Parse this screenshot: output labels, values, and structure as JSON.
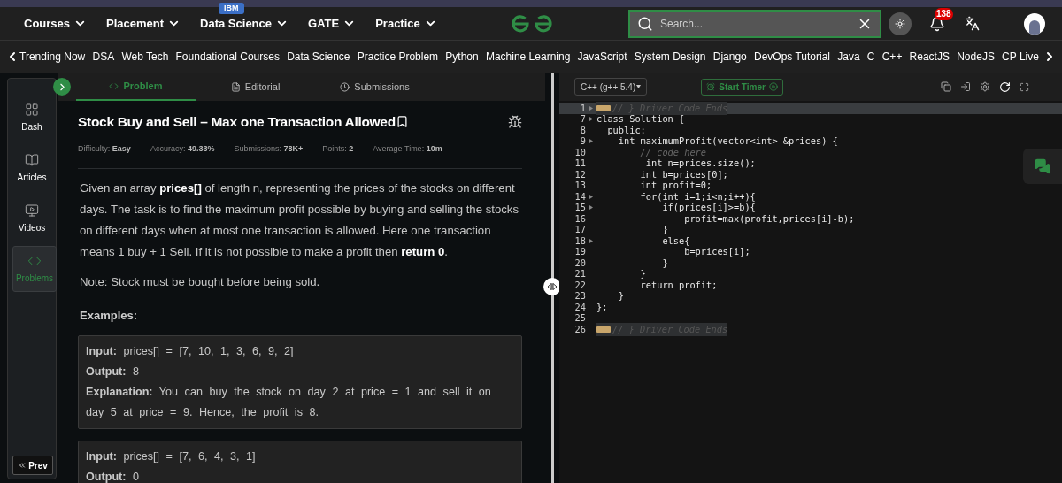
{
  "nav": {
    "items": [
      {
        "label": "Courses"
      },
      {
        "label": "Placement"
      },
      {
        "label": "Data Science",
        "badge": "IBM"
      },
      {
        "label": "GATE"
      },
      {
        "label": "Practice"
      }
    ],
    "search": {
      "placeholder": "Search..."
    },
    "notifications": "138"
  },
  "topics": [
    "Trending Now",
    "DSA",
    "Web Tech",
    "Foundational Courses",
    "Data Science",
    "Practice Problem",
    "Python",
    "Machine Learning",
    "JavaScript",
    "System Design",
    "Django",
    "DevOps Tutorial",
    "Java",
    "C",
    "C++",
    "ReactJS",
    "NodeJS",
    "CP Live"
  ],
  "sidebar": {
    "items": [
      {
        "label": "Dash",
        "selected": false
      },
      {
        "label": "Articles",
        "selected": false
      },
      {
        "label": "Videos",
        "selected": false
      },
      {
        "label": "Problems",
        "selected": true
      }
    ],
    "prev": "Prev"
  },
  "tabs": [
    {
      "label": "Problem",
      "selected": true
    },
    {
      "label": "Editorial",
      "selected": false
    },
    {
      "label": "Submissions",
      "selected": false
    }
  ],
  "problem": {
    "title": "Stock Buy and Sell – Max one Transaction Allowed",
    "meta": [
      "Difficulty: **Easy**",
      "Accuracy: **49.33%**",
      "Submissions: **78K+**",
      "Points: **2**",
      "Average Time: **10m**"
    ],
    "paragraphs": [
      "Given an array **prices[]** of length n, representing the prices of the stocks on different days. The task is to find the maximum profit possible by buying and selling the stocks on different days when at most one transaction is allowed. Here one transaction means 1 buy + 1 Sell. If it is not possible to make a profit then **return 0**.",
      "Note: Stock must be bought before being sold."
    ],
    "examples_heading": "Examples:",
    "examples": [
      [
        "**Input:** prices[] = [7, 10, 1, 3, 6, 9, 2]",
        "**Output:** 8",
        "**Explanation:** You can buy the stock on day 2 at price = 1 and sell it on day 5 at price = 9. Hence, the profit is 8."
      ],
      [
        "**Input:** prices[] = [7, 6, 4, 3, 1]",
        "**Output:** 0"
      ]
    ]
  },
  "editor": {
    "language": "C++ (g++ 5.4)",
    "timer": "Start Timer",
    "lines": [
      {
        "number": "1",
        "code": "// } Driver Code Ends",
        "kind": "folded",
        "foldable": true
      },
      {
        "number": "7",
        "code": "class Solution {",
        "kind": "code",
        "foldable": true
      },
      {
        "number": "8",
        "code": "  public:",
        "kind": "code",
        "foldable": false
      },
      {
        "number": "9",
        "code": "    int maximumProfit(vector<int> &prices) {",
        "kind": "code",
        "foldable": true
      },
      {
        "number": "10",
        "code": "        // code here",
        "kind": "comment",
        "foldable": false
      },
      {
        "number": "11",
        "code": "         int n=prices.size();",
        "kind": "code",
        "foldable": false
      },
      {
        "number": "12",
        "code": "        int b=prices[0];",
        "kind": "code",
        "foldable": false
      },
      {
        "number": "13",
        "code": "        int profit=0;",
        "kind": "code",
        "foldable": false
      },
      {
        "number": "14",
        "code": "        for(int i=1;i<n;i++){",
        "kind": "code",
        "foldable": true
      },
      {
        "number": "15",
        "code": "            if(prices[i]>=b){",
        "kind": "code",
        "foldable": true
      },
      {
        "number": "16",
        "code": "                profit=max(profit,prices[i]-b);",
        "kind": "code",
        "foldable": false
      },
      {
        "number": "17",
        "code": "            }",
        "kind": "code",
        "foldable": false
      },
      {
        "number": "18",
        "code": "            else{",
        "kind": "code",
        "foldable": true
      },
      {
        "number": "19",
        "code": "                b=prices[i];",
        "kind": "code",
        "foldable": false
      },
      {
        "number": "20",
        "code": "            }",
        "kind": "code",
        "foldable": false
      },
      {
        "number": "21",
        "code": "        }",
        "kind": "code",
        "foldable": false
      },
      {
        "number": "22",
        "code": "        return profit;",
        "kind": "code",
        "foldable": false
      },
      {
        "number": "23",
        "code": "    }",
        "kind": "code",
        "foldable": false
      },
      {
        "number": "24",
        "code": "};",
        "kind": "code",
        "foldable": false
      },
      {
        "number": "25",
        "kind": "code",
        "foldable": false
      },
      {
        "number": "26",
        "code": "// } Driver Code Ends",
        "kind": "folded",
        "foldable": false
      }
    ]
  }
}
